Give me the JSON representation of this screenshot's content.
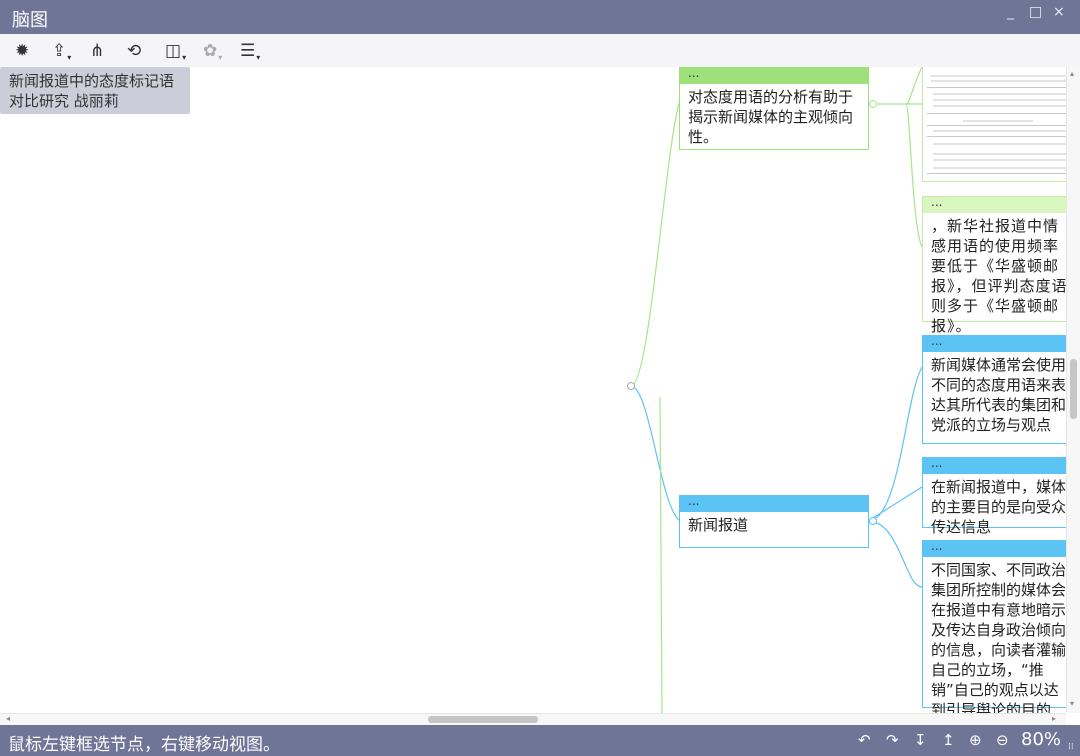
{
  "window": {
    "title": "脑图",
    "minimize_label": "_",
    "maximize_label": "□",
    "close_label": "×"
  },
  "toolbar": {
    "icons": [
      "gear-icon",
      "export-icon",
      "structure-icon",
      "target-icon",
      "layout-icon",
      "theme-icon",
      "outline-icon"
    ],
    "gear_glyph": "✹",
    "export_glyph": "⇪",
    "structure_glyph": "⋔",
    "target_glyph": "⟲",
    "layout_glyph": "◫",
    "theme_glyph": "✿",
    "outline_glyph": "☰",
    "caret": "▾"
  },
  "mindmap": {
    "root": "新闻报道中的态度标记语对比研究 战丽莉",
    "nodes": [
      {
        "header": "...",
        "text": "对态度用语的分析有助于揭示新闻媒体的主观倾向性。"
      },
      {
        "header": "...",
        "text": "新闻报道"
      }
    ],
    "leaves": [
      {
        "header": "...",
        "text": "，新华社报道中情感用语的使用频率要低于《华盛顿邮报》，但评判态度语则多于《华盛顿邮报》。"
      },
      {
        "header": "...",
        "text": "新闻媒体通常会使用不同的态度用语来表达其所代表的集团和党派的立场与观点"
      },
      {
        "header": "...",
        "text": "在新闻报道中，媒体的主要目的是向受众传达信息"
      },
      {
        "header": "...",
        "text": "不同国家、不同政治集团所控制的媒体会在报道中有意地暗示及传达自身政治倾向的信息，向读者灌输自己的立场，“推销”自己的观点以达到引导舆论的目的"
      }
    ]
  },
  "status": {
    "hint": "鼠标左键框选节点，右键移动视图。",
    "undo": "↶",
    "redo": "↷",
    "expand": "↧",
    "collapse": "↥",
    "zoom_in": "⊕",
    "zoom_out": "⊖",
    "zoom": "80%",
    "grip": "⁞⁞"
  },
  "scroll": {
    "left_arrow": "◂",
    "right_arrow": "▸",
    "up_arrow": "▴",
    "down_arrow": "▾"
  },
  "colors": {
    "titlebar": "#6e7596",
    "green_branch": "#9ee07a",
    "light_green_branch": "#d9f5c0",
    "blue_branch": "#5cc3f5",
    "root": "#cccdd8"
  }
}
